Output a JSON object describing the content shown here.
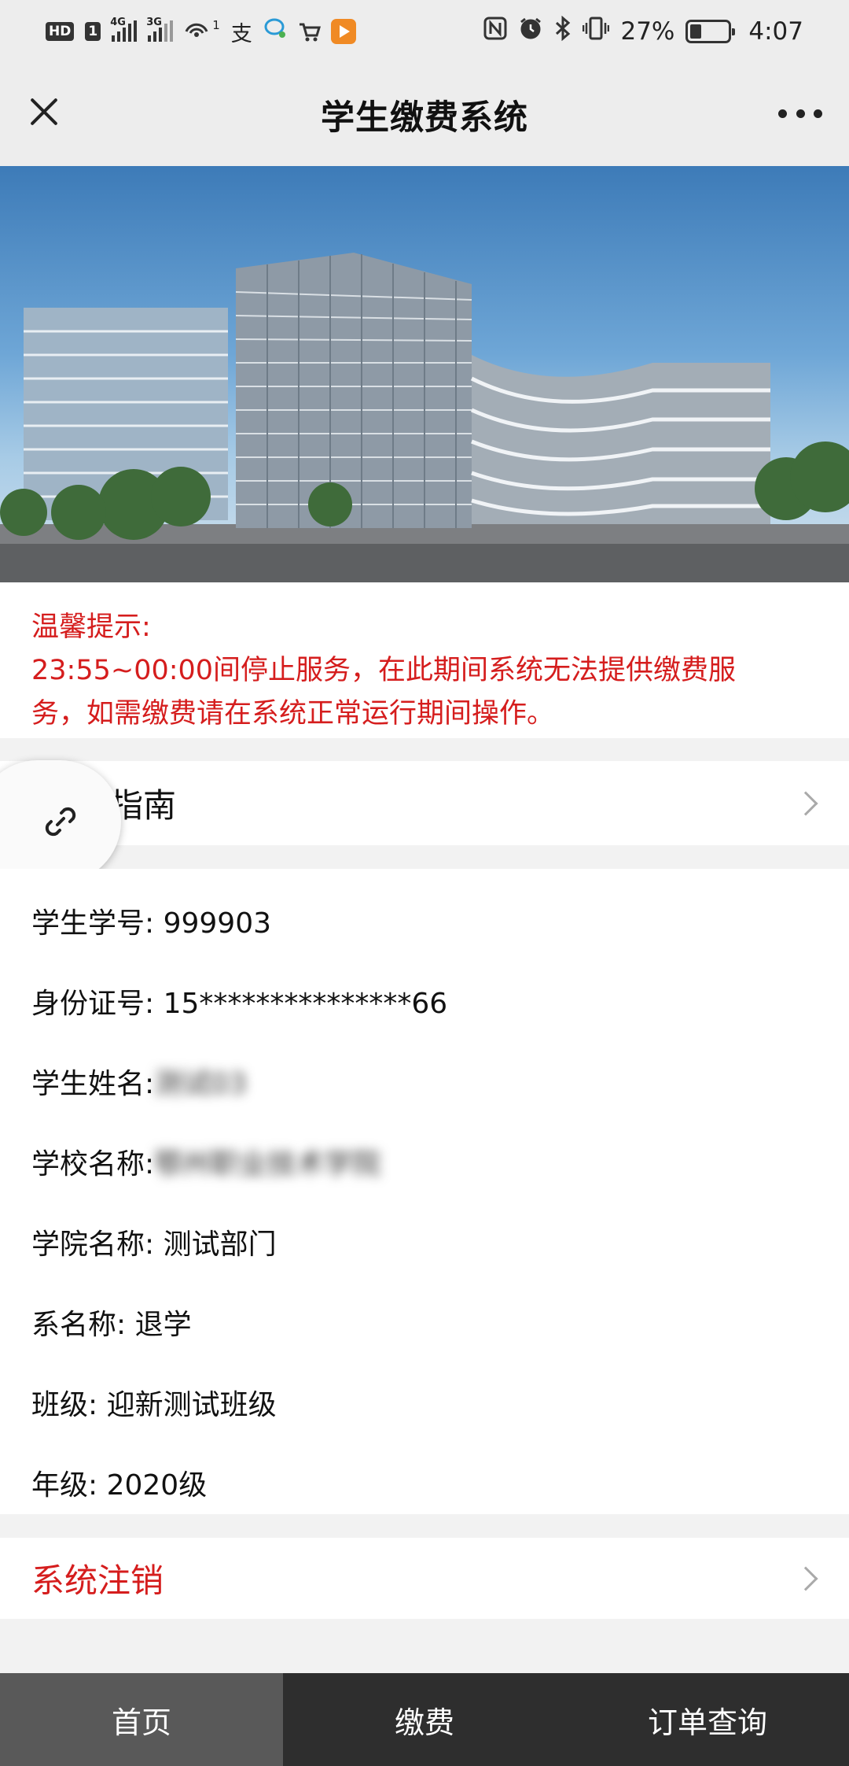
{
  "status_bar": {
    "hd_label": "HD",
    "sim1": "1",
    "sig1_net": "4G",
    "sig2_net": "3G",
    "hotspot_sup": "1",
    "alipay_glyph": "支",
    "battery_pct": "27%",
    "time": "4:07",
    "nfc_glyph": "N"
  },
  "header": {
    "title": "学生缴费系统"
  },
  "notice": {
    "heading": "温馨提示:",
    "line1": "23:55~00:00间停止服务，在此期间系统无法提供缴费服",
    "line2": "务，如需缴费请在系统正常运行期间操作。"
  },
  "guide": {
    "label": "指南"
  },
  "student_info": {
    "student_id": "学生学号: 999903",
    "id_card": "身份证号: 15***************66",
    "name_label": "学生姓名: ",
    "name_value": "测试03",
    "school_label": "学校名称: ",
    "school_value": "鄂州职业技术学院",
    "college": "学院名称: 测试部门",
    "department": "系名称: 退学",
    "class": "班级: 迎新测试班级",
    "grade": "年级: 2020级"
  },
  "logout": {
    "label": "系统注销"
  },
  "tabs": [
    {
      "label": "首页"
    },
    {
      "label": "缴费"
    },
    {
      "label": "订单查询"
    }
  ],
  "colors": {
    "accent_red": "#d51d1d",
    "tab_bar": "#2e2e2e",
    "tab_active": "#595959"
  }
}
